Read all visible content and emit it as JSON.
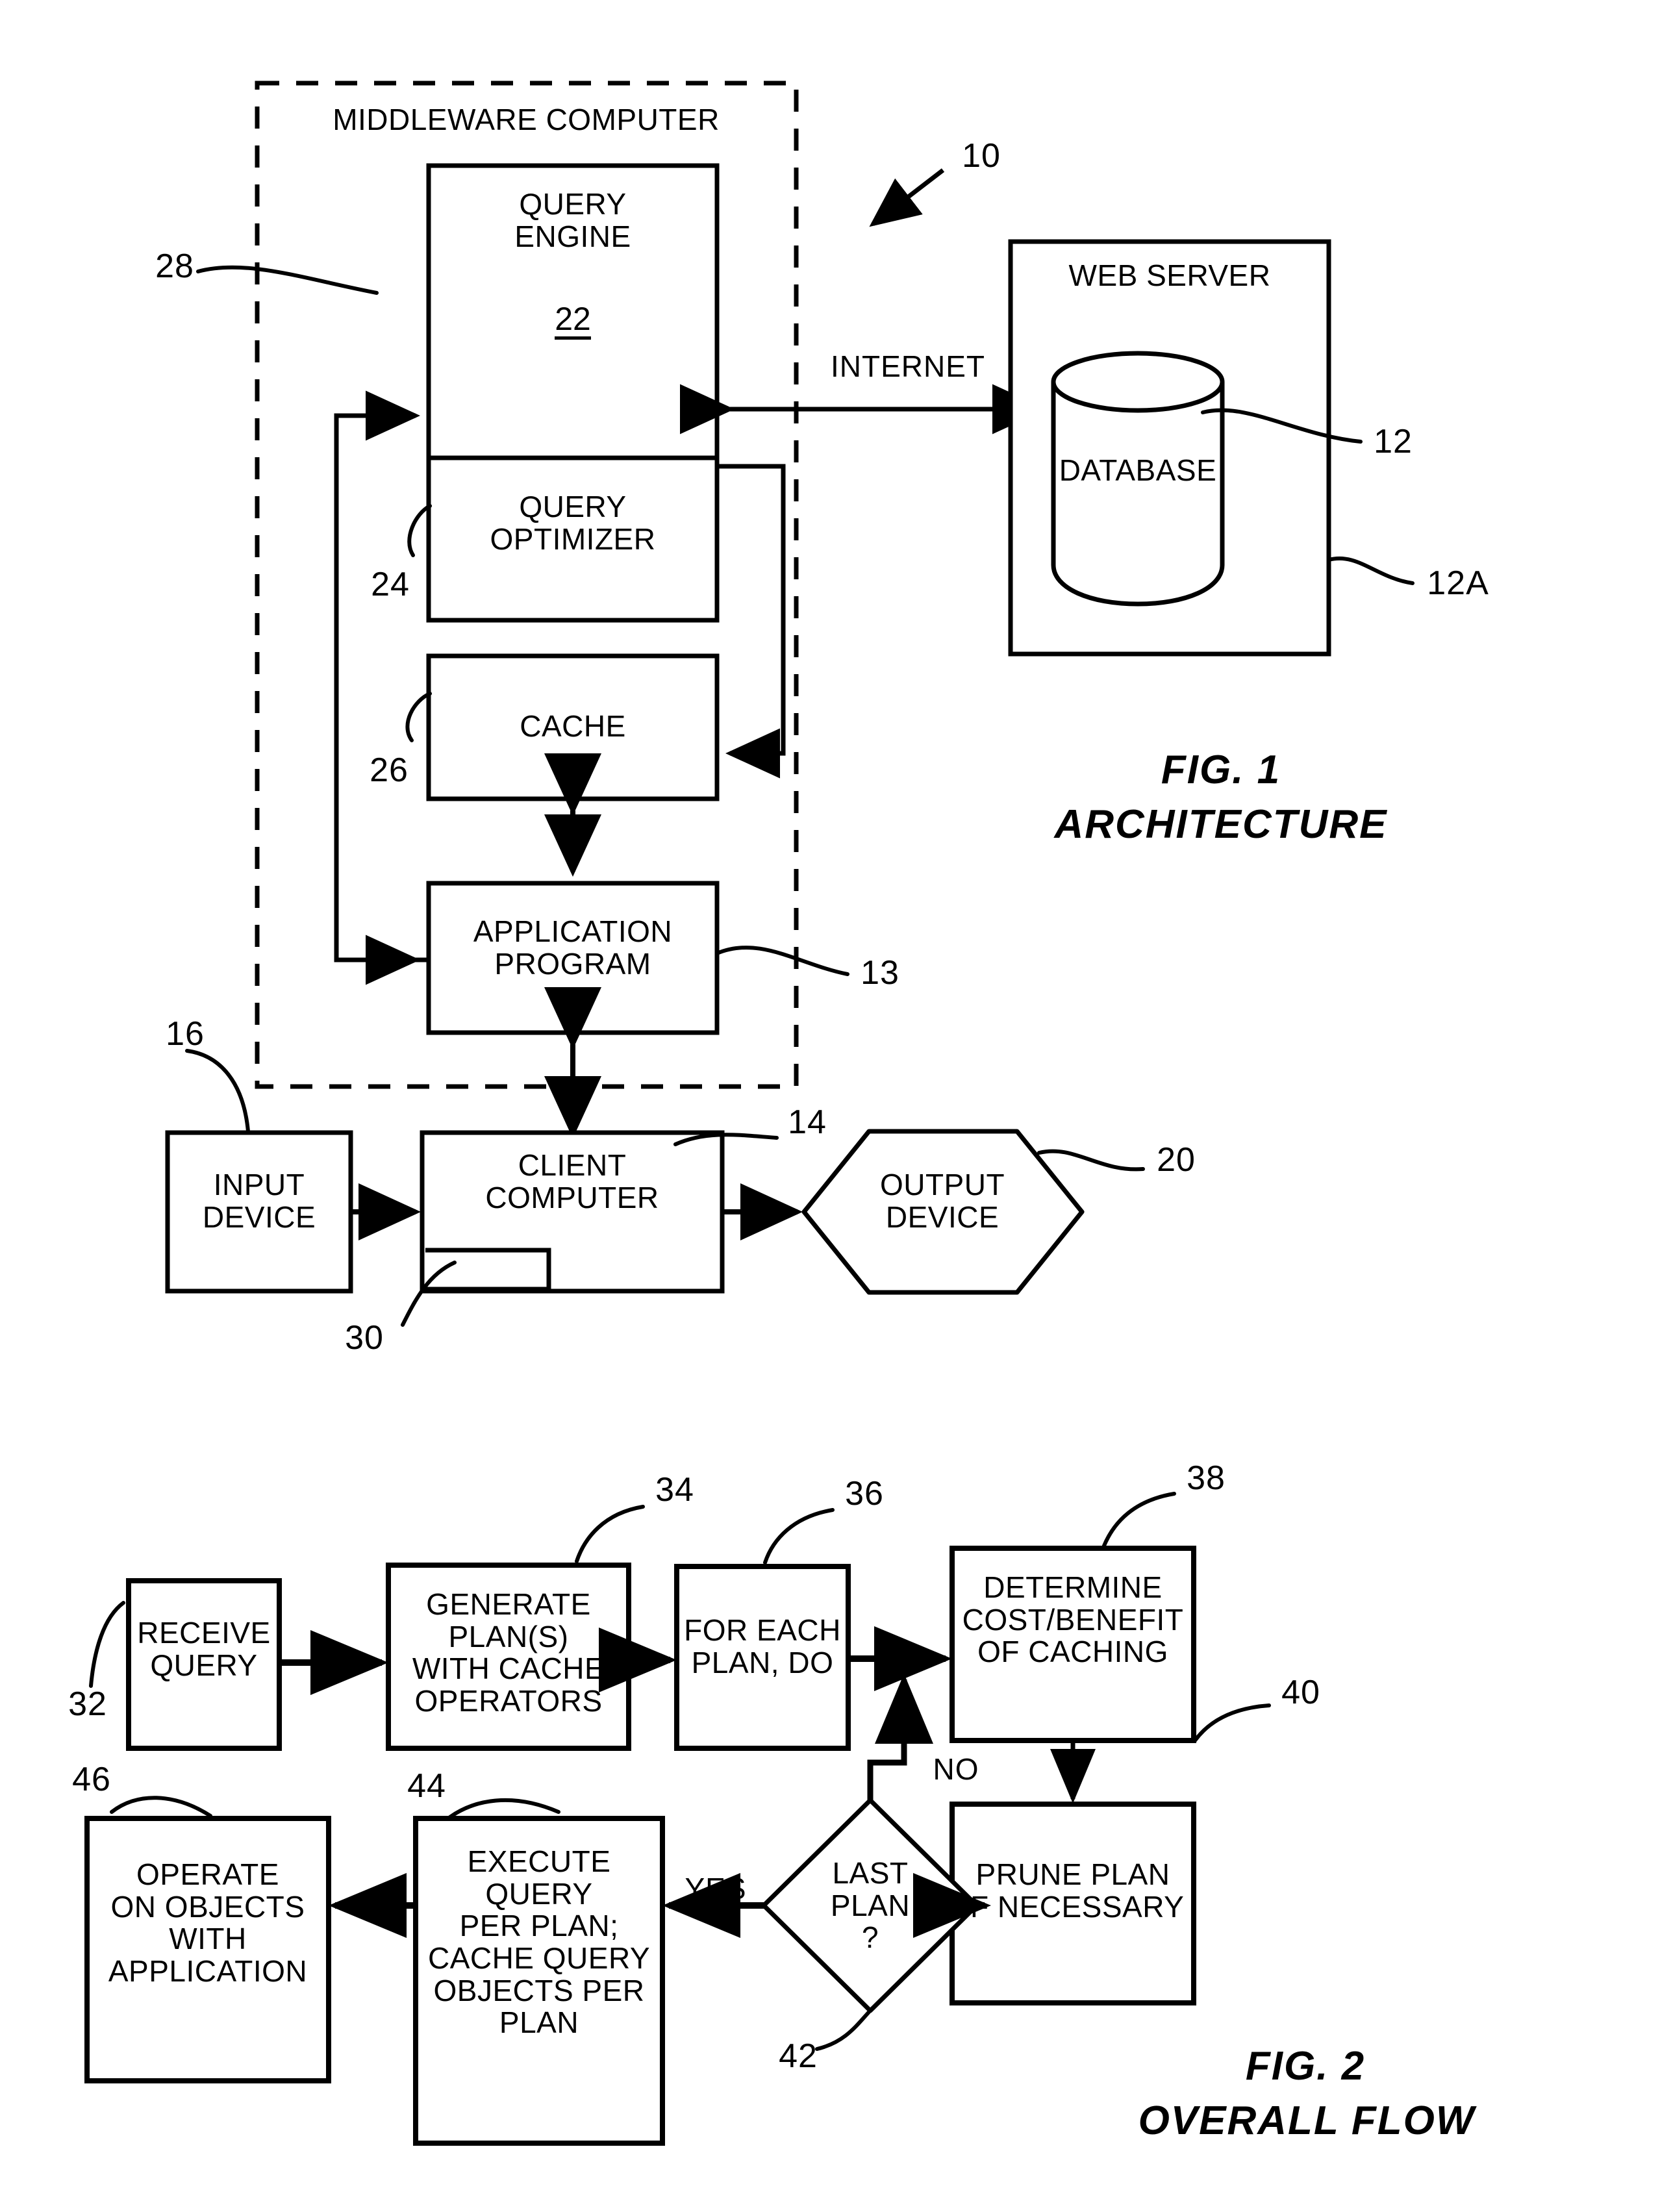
{
  "document": {
    "kind": "patent-drawing-sheet",
    "figures": [
      {
        "id": "fig1",
        "caption_line1": "FIG. 1",
        "caption_line2": "ARCHITECTURE",
        "enclosure_label": "MIDDLEWARE COMPUTER",
        "nodes": [
          {
            "key": "query_engine",
            "label": "QUERY\nENGINE",
            "ref": "22"
          },
          {
            "key": "query_optimizer",
            "label": "QUERY\nOPTIMIZER",
            "ref": "24"
          },
          {
            "key": "cache",
            "label": "CACHE",
            "ref": "26"
          },
          {
            "key": "application_program",
            "label": "APPLICATION\nPROGRAM",
            "ref": "13"
          },
          {
            "key": "web_server",
            "label": "WEB SERVER",
            "ref": "12A"
          },
          {
            "key": "database",
            "label": "DATABASE",
            "ref": "12"
          },
          {
            "key": "input_device",
            "label": "INPUT\nDEVICE",
            "ref": "16"
          },
          {
            "key": "client_computer",
            "label": "CLIENT\nCOMPUTER",
            "ref": "14"
          },
          {
            "key": "client_subunit",
            "label": "",
            "ref": "30"
          },
          {
            "key": "output_device",
            "label": "OUTPUT\nDEVICE",
            "ref": "20"
          }
        ],
        "edge_labels": [
          {
            "key": "internet",
            "label": "INTERNET"
          }
        ],
        "reference_numerals": {
          "system": "10",
          "database": "12",
          "web_server": "12A",
          "application_program": "13",
          "client_computer": "14",
          "input_device": "16",
          "output_device": "20",
          "query_engine": "22",
          "query_optimizer": "24",
          "cache": "26",
          "middleware_computer": "28",
          "client_subunit": "30"
        }
      },
      {
        "id": "fig2",
        "caption_line1": "FIG. 2",
        "caption_line2": "OVERALL FLOW",
        "nodes": [
          {
            "key": "receive_query",
            "label": "RECEIVE\nQUERY",
            "ref": "32",
            "shape": "rect"
          },
          {
            "key": "generate_plans",
            "label": "GENERATE PLAN(S)\nWITH CACHE\nOPERATORS",
            "ref": "34",
            "shape": "rect"
          },
          {
            "key": "for_each_plan",
            "label": "FOR EACH\nPLAN, DO",
            "ref": "36",
            "shape": "rect"
          },
          {
            "key": "determine_cost_benefit",
            "label": "DETERMINE\nCOST/BENEFIT\nOF CACHING",
            "ref": "38",
            "shape": "rect"
          },
          {
            "key": "prune_plan",
            "label": "PRUNE PLAN\nIF NECESSARY",
            "ref": "40",
            "shape": "rect"
          },
          {
            "key": "last_plan",
            "label": "LAST\nPLAN\n?",
            "ref": "42",
            "shape": "diamond"
          },
          {
            "key": "execute_query",
            "label": "EXECUTE QUERY\nPER PLAN;\nCACHE QUERY\nOBJECTS PER\nPLAN",
            "ref": "44",
            "shape": "rect"
          },
          {
            "key": "operate_on_objects",
            "label": "OPERATE\nON OBJECTS\nWITH\nAPPLICATION",
            "ref": "46",
            "shape": "rect"
          }
        ],
        "edge_labels": [
          {
            "key": "yes",
            "label": "YES"
          },
          {
            "key": "no",
            "label": "NO"
          }
        ],
        "reference_numerals": {
          "receive_query": "32",
          "generate_plans": "34",
          "for_each_plan": "36",
          "determine_cost_benefit": "38",
          "prune_plan": "40",
          "last_plan": "42",
          "execute_query": "44",
          "operate_on_objects": "46"
        }
      }
    ],
    "colors": {
      "ink": "#000000",
      "paper": "#ffffff"
    }
  }
}
